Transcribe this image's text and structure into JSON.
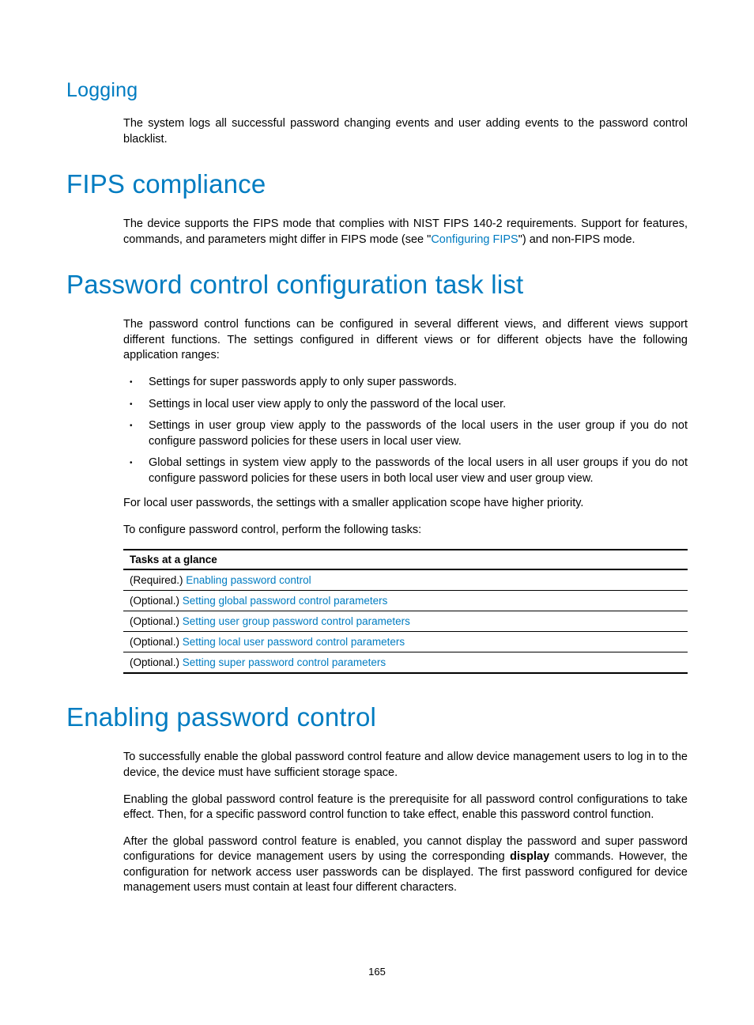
{
  "logging": {
    "heading": "Logging",
    "p1": "The system logs all successful password changing events and user adding events to the password control blacklist."
  },
  "fips": {
    "heading": "FIPS compliance",
    "p1_pre": "The device supports the FIPS mode that complies with NIST FIPS 140-2 requirements. Support for features, commands, and parameters might differ in FIPS mode (see \"",
    "p1_link": "Configuring FIPS",
    "p1_post": "\") and non-FIPS mode."
  },
  "tasklist": {
    "heading": "Password control configuration task list",
    "p1": "The password control functions can be configured in several different views, and different views support different functions. The settings configured in different views or for different objects have the following application ranges:",
    "bullets": [
      "Settings for super passwords apply to only super passwords.",
      "Settings in local user view apply to only the password of the local user.",
      "Settings in user group view apply to the passwords of the local users in the user group if you do not configure password policies for these users in local user view.",
      "Global settings in system view apply to the passwords of the local users in all user groups if you do not configure password policies for these users in both local user view and user group view."
    ],
    "p2": "For local user passwords, the settings with a smaller application scope have higher priority.",
    "p3": "To configure password control, perform the following tasks:",
    "table_header": "Tasks at a glance",
    "rows": [
      {
        "prefix": "(Required.) ",
        "link": "Enabling password control"
      },
      {
        "prefix": "(Optional.) ",
        "link": "Setting global password control parameters"
      },
      {
        "prefix": "(Optional.) ",
        "link": "Setting user group password control parameters"
      },
      {
        "prefix": "(Optional.) ",
        "link": "Setting local user password control parameters"
      },
      {
        "prefix": "(Optional.) ",
        "link": "Setting super password control parameters"
      }
    ]
  },
  "enabling": {
    "heading": "Enabling password control",
    "p1": "To successfully enable the global password control feature and allow device management users to log in to the device, the device must have sufficient storage space.",
    "p2": "Enabling the global password control feature is the prerequisite for all password control configurations to take effect. Then, for a specific password control function to take effect, enable this password control function.",
    "p3_pre": "After the global password control feature is enabled, you cannot display the password and super password configurations for device management users by using the corresponding ",
    "p3_bold": "display",
    "p3_post": " commands. However, the configuration for network access user passwords can be displayed. The first password configured for device management users must contain at least four different characters."
  },
  "page_number": "165"
}
